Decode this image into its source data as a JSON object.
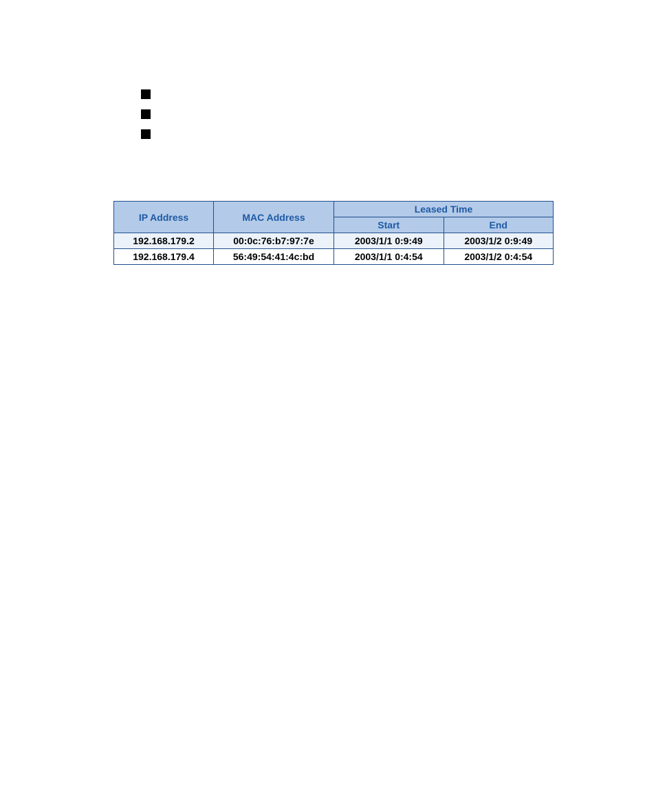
{
  "table": {
    "headers": {
      "ip": "IP Address",
      "mac": "MAC Address",
      "leased": "Leased Time",
      "start": "Start",
      "end": "End"
    },
    "rows": [
      {
        "ip": "192.168.179.2",
        "mac": "00:0c:76:b7:97:7e",
        "start": "2003/1/1 0:9:49",
        "end": "2003/1/2 0:9:49"
      },
      {
        "ip": "192.168.179.4",
        "mac": "56:49:54:41:4c:bd",
        "start": "2003/1/1 0:4:54",
        "end": "2003/1/2 0:4:54"
      }
    ]
  }
}
